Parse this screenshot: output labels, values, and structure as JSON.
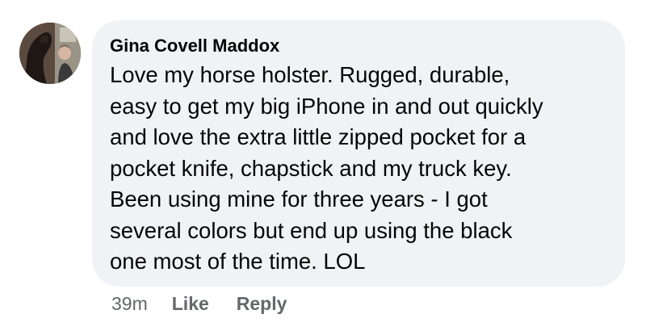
{
  "comment": {
    "author": "Gina Covell Maddox",
    "text": "Love my horse holster. Rugged, durable,\neasy to get my big iPhone in and out quickly\nand love the extra little zipped pocket for a\npocket knife, chapstick and my truck key.\nBeen using mine for three years - I got\nseveral colors but end up using the black\none most of the time. LOL",
    "timestamp": "39m",
    "like_label": "Like",
    "reply_label": "Reply",
    "avatar_icon": "profile-photo-avatar"
  },
  "colors": {
    "bubble_bg": "#f0f2f5",
    "text": "#050505",
    "secondary_text": "#65676b"
  }
}
